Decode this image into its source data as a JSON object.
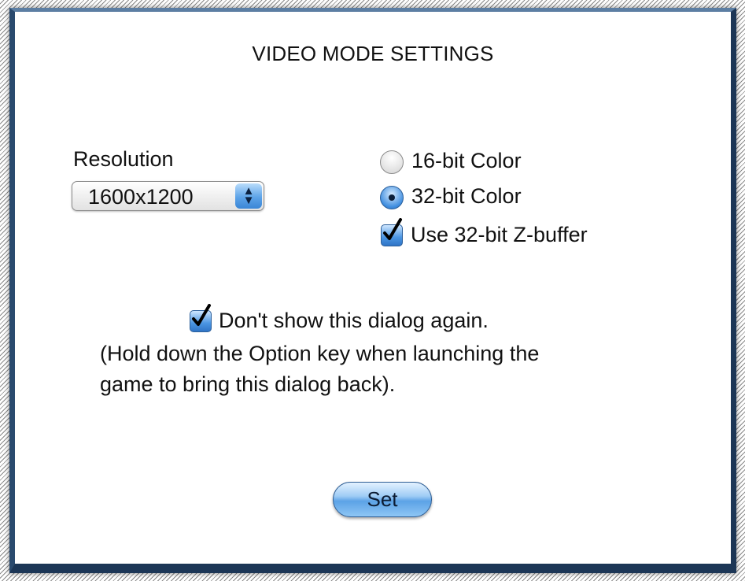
{
  "dialog": {
    "title": "VIDEO MODE SETTINGS",
    "resolution": {
      "label": "Resolution",
      "selected": "1600x1200"
    },
    "color_options": [
      {
        "label": "16-bit Color",
        "selected": false
      },
      {
        "label": "32-bit Color",
        "selected": true
      }
    ],
    "zbuffer": {
      "label": "Use 32-bit Z-buffer",
      "checked": true
    },
    "dont_show": {
      "label": "Don't show this dialog again.",
      "checked": true
    },
    "hint_line1": "(Hold down the Option key when launching the",
    "hint_line2": "game to bring this dialog back).",
    "set_label": "Set"
  },
  "colors": {
    "accent": "#3e8ddf",
    "frame": "#1c3656"
  },
  "icons": [
    "chevron-updown-icon",
    "checkmark-icon"
  ]
}
